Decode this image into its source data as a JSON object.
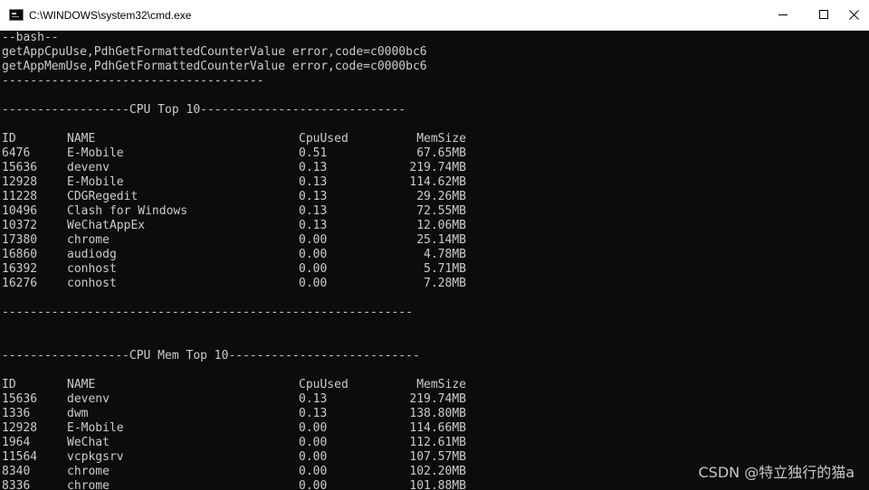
{
  "window": {
    "title": "C:\\WINDOWS\\system32\\cmd.exe",
    "icon": "cmd-icon",
    "controls": [
      "minimize-icon",
      "maximize-icon",
      "close-icon"
    ]
  },
  "console": {
    "header_lines": [
      "--bash--",
      "getAppCpuUse,PdhGetFormattedCounterValue error,code=c0000bc6",
      "getAppMemUse,PdhGetFormattedCounterValue error,code=c0000bc6",
      "-------------------------------------"
    ],
    "cpu_section": {
      "title_line": "------------------CPU Top 10-----------------------------",
      "columns": [
        "ID",
        "NAME",
        "CpuUsed",
        "MemSize"
      ],
      "rows": [
        [
          "6476",
          "E-Mobile",
          "0.51",
          "67.65MB"
        ],
        [
          "15636",
          "devenv",
          "0.13",
          "219.74MB"
        ],
        [
          "12928",
          "E-Mobile",
          "0.13",
          "114.62MB"
        ],
        [
          "11228",
          "CDGRegedit",
          "0.13",
          "29.26MB"
        ],
        [
          "10496",
          "Clash for Windows",
          "0.13",
          "72.55MB"
        ],
        [
          "10372",
          "WeChatAppEx",
          "0.13",
          "12.06MB"
        ],
        [
          "17380",
          "chrome",
          "0.00",
          "25.14MB"
        ],
        [
          "16860",
          "audiodg",
          "0.00",
          "4.78MB"
        ],
        [
          "16392",
          "conhost",
          "0.00",
          "5.71MB"
        ],
        [
          "16276",
          "conhost",
          "0.00",
          "7.28MB"
        ]
      ],
      "footer_line": "----------------------------------------------------------"
    },
    "mem_section": {
      "title_line": "------------------CPU Mem Top 10---------------------------",
      "columns": [
        "ID",
        "NAME",
        "CpuUsed",
        "MemSize"
      ],
      "rows": [
        [
          "15636",
          "devenv",
          "0.13",
          "219.74MB"
        ],
        [
          "1336",
          "dwm",
          "0.13",
          "138.80MB"
        ],
        [
          "12928",
          "E-Mobile",
          "0.00",
          "114.66MB"
        ],
        [
          "1964",
          "WeChat",
          "0.00",
          "112.61MB"
        ],
        [
          "11564",
          "vcpkgsrv",
          "0.00",
          "107.57MB"
        ],
        [
          "8340",
          "chrome",
          "0.00",
          "102.20MB"
        ],
        [
          "8336",
          "chrome",
          "0.00",
          "101.88MB"
        ]
      ]
    }
  },
  "watermark": "CSDN @特立独行的猫a",
  "colors": {
    "console_background": "#0c0c0c",
    "console_text": "#cccccc",
    "titlebar_background": "#ffffff"
  }
}
